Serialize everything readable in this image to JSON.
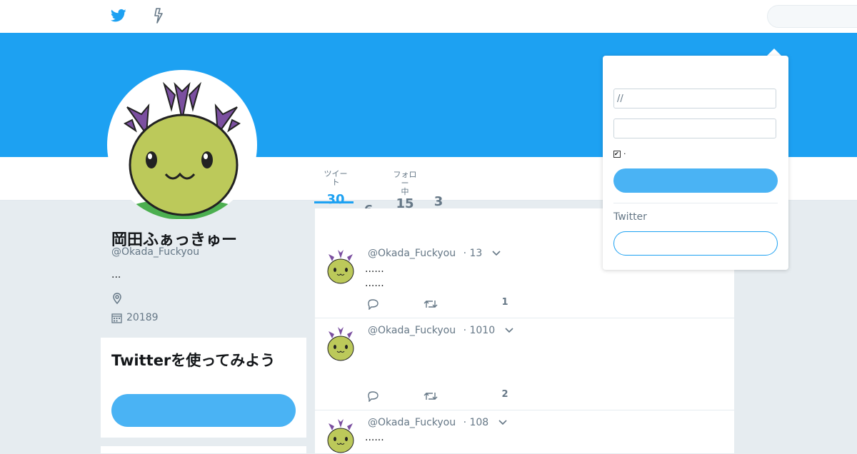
{
  "nav": {
    "bird_icon": "twitter-bird-icon",
    "moments_icon": "lightning-icon",
    "search_placeholder": ""
  },
  "stats": [
    {
      "label": "ツイート",
      "value": "30"
    },
    {
      "label": "",
      "value": "6"
    },
    {
      "label": "フォロー\n中",
      "value": "15"
    },
    {
      "label": "",
      "value": "3"
    }
  ],
  "profile": {
    "name": "岡田ふぁっきゅー",
    "handle": "@Okada_Fuckyou",
    "bio": "...",
    "location": "",
    "joined": "20189"
  },
  "signup_card": {
    "title": "Twitterを使ってみよう",
    "button_label": ""
  },
  "tweets": [
    {
      "handle": "@Okada_Fuckyou",
      "time": "· 13",
      "lines": [
        "......",
        "......"
      ],
      "likes": "1"
    },
    {
      "handle": "@Okada_Fuckyou",
      "time": "· 1010",
      "lines": [],
      "likes": "2"
    },
    {
      "handle": "@Okada_Fuckyou",
      "time": "· 108",
      "lines": [
        "......"
      ],
      "likes": ""
    }
  ],
  "login": {
    "username_value": "//",
    "password_value": "",
    "remember_label": "·",
    "login_label": "",
    "twitter_label": "Twitter",
    "signup_label": ""
  },
  "colors": {
    "brand": "#1da1f2",
    "button": "#4ab3f4",
    "background": "#e6ecf0"
  }
}
